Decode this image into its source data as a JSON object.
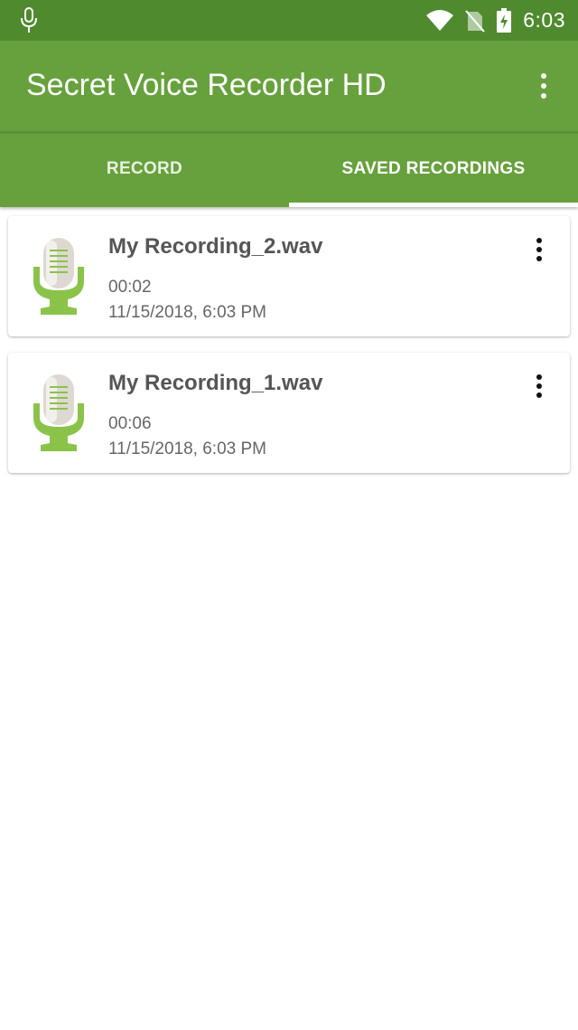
{
  "status_bar": {
    "time": "6:03",
    "icons": [
      "microphone-icon",
      "wifi-icon",
      "no-sim-icon",
      "battery-charging-icon"
    ]
  },
  "app_bar": {
    "title": "Secret Voice Recorder HD",
    "menu_icon": "more-vert-icon"
  },
  "tabs": [
    {
      "label": "RECORD",
      "selected": false
    },
    {
      "label": "SAVED RECORDINGS",
      "selected": true
    }
  ],
  "recordings": [
    {
      "name": "My Recording_2.wav",
      "duration": "00:02",
      "date": "11/15/2018, 6:03 PM",
      "icon": "microphone-icon",
      "menu_icon": "more-vert-icon"
    },
    {
      "name": "My Recording_1.wav",
      "duration": "00:06",
      "date": "11/15/2018, 6:03 PM",
      "icon": "microphone-icon",
      "menu_icon": "more-vert-icon"
    }
  ],
  "colors": {
    "status_bar": "#4f8a2f",
    "primary": "#67a13d",
    "accent_icon": "#8bc34a",
    "indicator": "#ffffff"
  }
}
